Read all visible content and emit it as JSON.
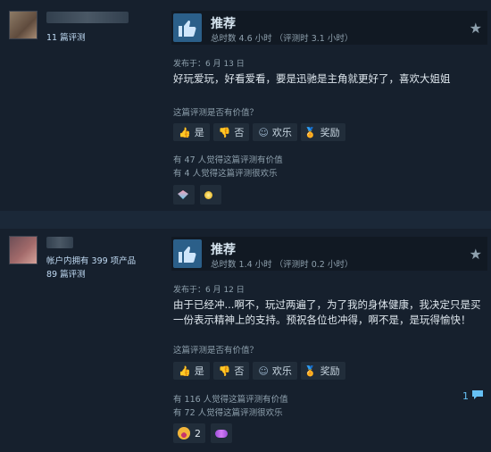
{
  "reviews": [
    {
      "author_reviews": "11 篇评测",
      "products_owned": "",
      "recommendation": "推荐",
      "hours": "总时数 4.6 小时 （评测时 3.1 小时）",
      "posted": "发布于：6 月 13 日",
      "body": "好玩爱玩，好看爱看，要是迅驰是主角就更好了，喜欢大姐姐",
      "helpful_question": "这篇评测是否有价值？",
      "buttons": {
        "yes": "是",
        "no": "否",
        "funny": "欢乐",
        "award": "奖励"
      },
      "helpful_count": "有 47 人觉得这篇评测有价值",
      "funny_count": "有 4 人觉得这篇评测很欢乐",
      "awards": [
        {
          "icon": "gem-award-icon",
          "count": ""
        },
        {
          "icon": "sun-award-icon",
          "count": ""
        }
      ]
    },
    {
      "author_reviews": "89 篇评测",
      "products_owned": "帐户内拥有 399 项产品",
      "recommendation": "推荐",
      "hours": "总时数 1.4 小时 （评测时 0.2 小时）",
      "posted": "发布于：6 月 12 日",
      "body": "由于已经冲...啊不，玩过两遍了，为了我的身体健康，我决定只是买一份表示精神上的支持。预祝各位也冲得，啊不是，是玩得愉快！",
      "helpful_question": "这篇评测是否有价值？",
      "buttons": {
        "yes": "是",
        "no": "否",
        "funny": "欢乐",
        "award": "奖励"
      },
      "helpful_count": "有 116 人觉得这篇评测有价值",
      "funny_count": "有 72 人觉得这篇评测很欢乐",
      "comments": "1",
      "awards": [
        {
          "icon": "laughing-face-award-icon",
          "count": "2"
        },
        {
          "icon": "candy-award-icon",
          "count": ""
        }
      ]
    }
  ],
  "colors": {
    "background": "#1b2838",
    "card": "#16202d",
    "thumb_box": "#2b5f89",
    "link": "#66c0f4"
  }
}
